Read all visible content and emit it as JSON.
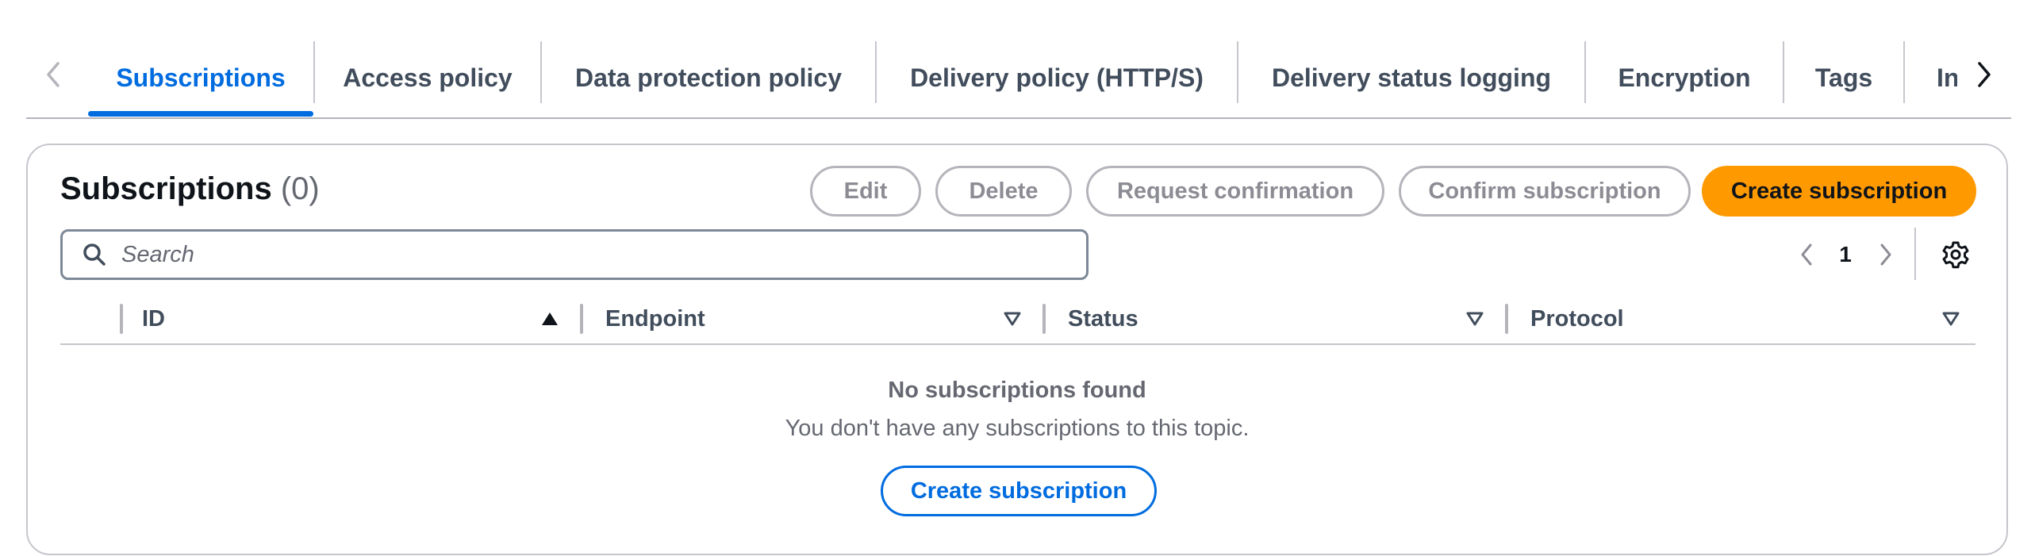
{
  "tabs": {
    "items": [
      {
        "label": "Subscriptions",
        "active": true
      },
      {
        "label": "Access policy",
        "active": false
      },
      {
        "label": "Data protection policy",
        "active": false
      },
      {
        "label": "Delivery policy (HTTP/S)",
        "active": false
      },
      {
        "label": "Delivery status logging",
        "active": false
      },
      {
        "label": "Encryption",
        "active": false
      },
      {
        "label": "Tags",
        "active": false
      },
      {
        "label": "Integrations",
        "active": false
      }
    ],
    "prev_icon": "chevron-left-icon",
    "next_icon": "chevron-right-icon"
  },
  "panel": {
    "title": "Subscriptions",
    "count": "(0)",
    "actions": {
      "edit": "Edit",
      "delete": "Delete",
      "request_confirmation": "Request confirmation",
      "confirm_subscription": "Confirm subscription",
      "create_subscription": "Create subscription"
    },
    "search": {
      "placeholder": "Search",
      "value": ""
    },
    "pagination": {
      "current_page": "1"
    },
    "settings_icon": "gear-icon"
  },
  "table": {
    "columns": [
      {
        "label": "ID",
        "sort": "ascending"
      },
      {
        "label": "Endpoint",
        "sort": "none"
      },
      {
        "label": "Status",
        "sort": "none"
      },
      {
        "label": "Protocol",
        "sort": "none"
      }
    ],
    "rows": []
  },
  "empty_state": {
    "title": "No subscriptions found",
    "description": "You don't have any subscriptions to this topic.",
    "button": "Create subscription"
  },
  "colors": {
    "accent": "#006ce0",
    "primary_button": "#ff9900",
    "border": "#c6c6cd",
    "text_secondary": "#656871"
  }
}
